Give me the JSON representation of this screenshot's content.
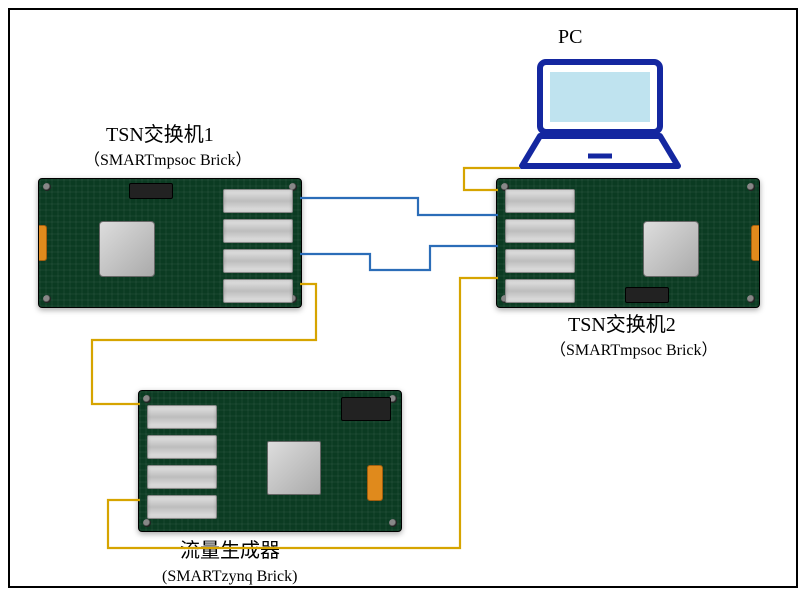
{
  "diagram": {
    "pc": {
      "label": "PC"
    },
    "switch1": {
      "name_cn": "TSN交换机1",
      "model": "（SMARTmpsoc Brick）"
    },
    "switch2": {
      "name_cn": "TSN交换机2",
      "model": "（SMARTmpsoc Brick）"
    },
    "trafficGen": {
      "name_cn": "流量生成器",
      "model": "(SMARTzynq Brick)"
    },
    "connections": {
      "blue": [
        {
          "from": "switch1-port-top",
          "to": "switch2-port-top"
        },
        {
          "from": "switch1-port-mid",
          "to": "switch2-port-mid"
        }
      ],
      "yellow": [
        {
          "from": "pc",
          "to": "switch2-port-top2"
        },
        {
          "from": "switch1-port-bottom",
          "to": "trafficGen-port-top"
        },
        {
          "from": "trafficGen-port-bottom",
          "to": "switch2-port-bottom"
        }
      ]
    },
    "boards": {
      "switch": {
        "ports": 4,
        "chip": "large-soc",
        "side_connector_color": "#e08a1c"
      },
      "trafficGen": {
        "ports": 4,
        "chip": "medium-fpga",
        "side_connector_color": "#e08a1c"
      }
    },
    "colors": {
      "pcb": "#0b3b22",
      "wire_blue": "#2b6db8",
      "wire_yellow": "#d6a400",
      "laptop": "#1427a0"
    }
  }
}
